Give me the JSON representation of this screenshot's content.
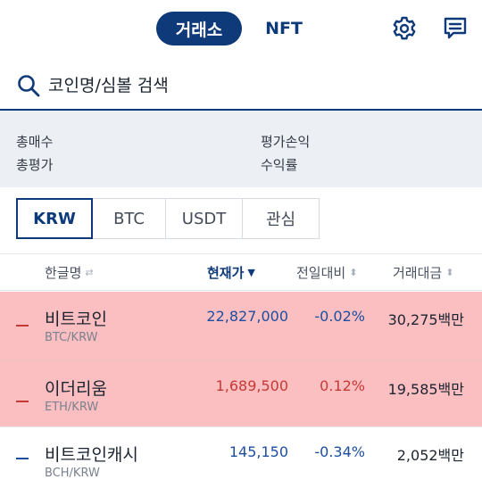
{
  "header": {
    "tab_exchange": "거래소",
    "tab_nft": "NFT",
    "settings_icon": "gear-icon",
    "chat_icon": "message-icon",
    "accent": "#0f3a79"
  },
  "search": {
    "placeholder": "코인명/심볼 검색",
    "icon": "search-icon"
  },
  "summary": {
    "total_buy": "총매수",
    "total_eval": "총평가",
    "eval_pl": "평가손익",
    "return_rate": "수익률"
  },
  "market_tabs": [
    "KRW",
    "BTC",
    "USDT",
    "관심"
  ],
  "active_market_tab": "KRW",
  "columns": {
    "name": "한글명",
    "price": "현재가",
    "change": "전일대비",
    "volume": "거래대금"
  },
  "colors": {
    "up": "#c53a35",
    "down": "#1c4fa0",
    "highlight": "#fbbec1"
  },
  "coins": [
    {
      "name": "비트코인",
      "symbol": "BTC/KRW",
      "price": "22,827,000",
      "change": "-0.02%",
      "volume": "30,275백만",
      "direction": "down",
      "highlighted": true
    },
    {
      "name": "이더리움",
      "symbol": "ETH/KRW",
      "price": "1,689,500",
      "change": "0.12%",
      "volume": "19,585백만",
      "direction": "up",
      "highlighted": true
    },
    {
      "name": "비트코인캐시",
      "symbol": "BCH/KRW",
      "price": "145,150",
      "change": "-0.34%",
      "volume": "2,052백만",
      "direction": "down",
      "highlighted": false
    }
  ]
}
